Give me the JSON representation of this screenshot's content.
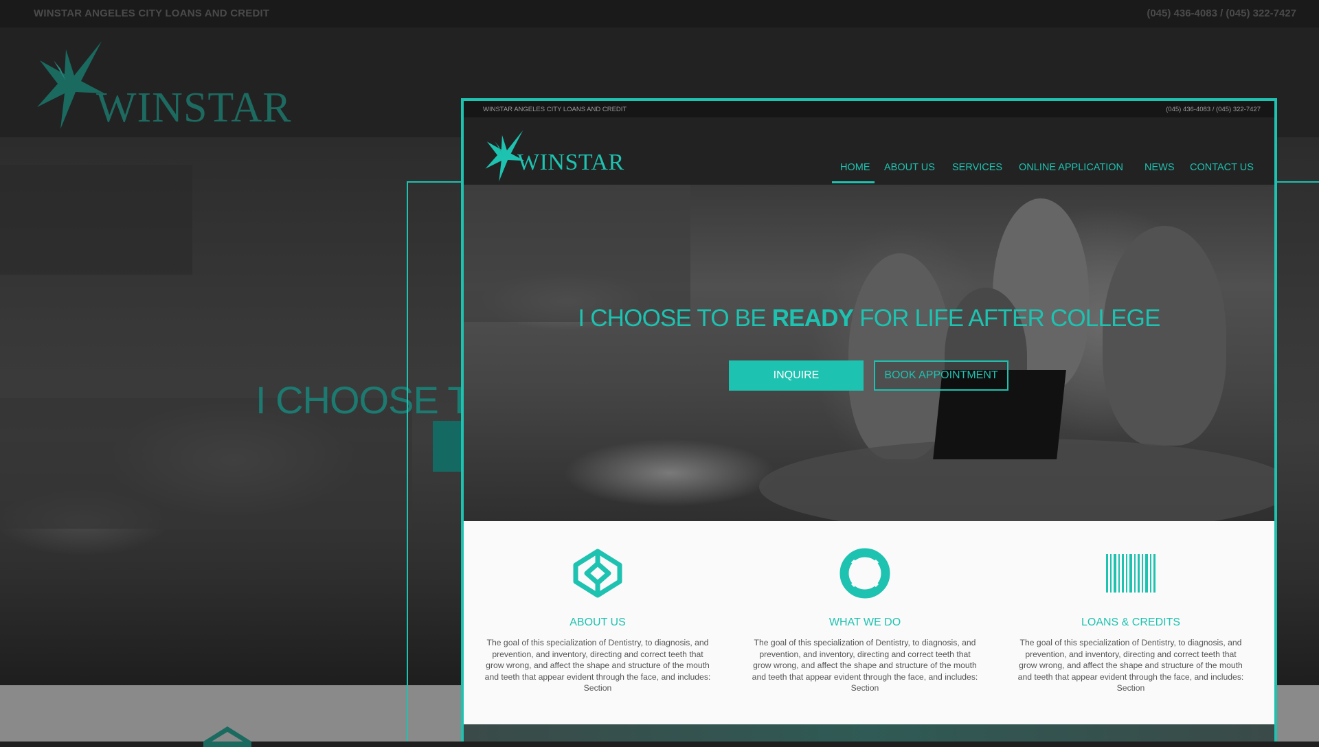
{
  "company_tagline": "WINSTAR ANGELES CITY LOANS AND CREDIT",
  "phones": "(045) 436-4083 / (045) 322-7427",
  "logo_text": "WINSTAR",
  "nav": [
    {
      "label": "HOME",
      "active": true
    },
    {
      "label": "ABOUT US",
      "active": false
    },
    {
      "label": "SERVICES",
      "active": false
    },
    {
      "label": "ONLINE APPLICATION",
      "active": false
    },
    {
      "label": "NEWS",
      "active": false
    },
    {
      "label": "CONTACT US",
      "active": false
    }
  ],
  "hero": {
    "title_pre": "I CHOOSE TO BE ",
    "title_bold": "READY",
    "title_post": " FOR LIFE AFTER COLLEGE",
    "bg_fragment": "I CHOOSE TO",
    "inquire_label": "INQUIRE",
    "book_label": "BOOK APPOINTMENT"
  },
  "features": [
    {
      "icon": "codepen-cube-icon",
      "title": "ABOUT US",
      "text": "The goal of this specialization of Dentistry, to diagnosis, and prevention, and inventory, directing and correct teeth that grow wrong, and affect the shape and structure of the mouth and teeth that appear evident through the face, and includes: Section"
    },
    {
      "icon": "lifebuoy-icon",
      "title": "WHAT WE DO",
      "text": "The goal of this specialization of Dentistry, to diagnosis, and prevention, and inventory, directing and correct teeth that grow wrong, and affect the shape and structure of the mouth and teeth that appear evident through the face, and includes: Section"
    },
    {
      "icon": "barcode-icon",
      "title": "LOANS & CREDITS",
      "text": "The goal of this specialization of Dentistry, to diagnosis, and prevention, and inventory, directing and correct teeth that grow wrong, and affect the shape and structure of the mouth and teeth that appear evident through the face, and includes: Section"
    }
  ],
  "colors": {
    "accent": "#1ec2b0",
    "dark": "#1f1f1f"
  }
}
